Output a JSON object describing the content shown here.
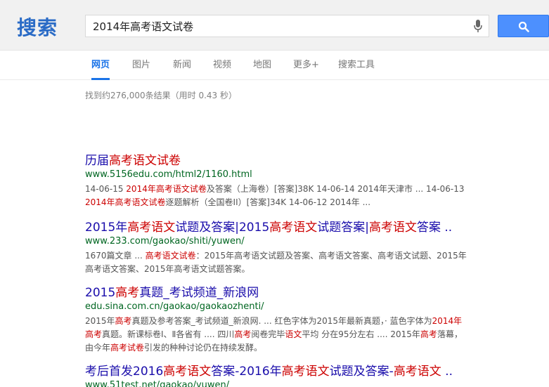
{
  "logo": "搜索",
  "search": {
    "query": "2014年高考语文试卷"
  },
  "tabs": [
    {
      "label": "网页",
      "active": true
    },
    {
      "label": "图片"
    },
    {
      "label": "新闻"
    },
    {
      "label": "视频"
    },
    {
      "label": "地图"
    },
    {
      "label": "更多+"
    },
    {
      "label": "搜索工具"
    }
  ],
  "stats": "找到约276,000条结果（用时 0.43 秒）",
  "results": [
    {
      "title": [
        {
          "t": "历届"
        },
        {
          "t": "高考语文试卷",
          "hl": true
        }
      ],
      "url": "www.5156edu.com/html2/1160.html",
      "snippet": [
        {
          "t": "14-06-15 "
        },
        {
          "t": "2014年高考语文试卷",
          "hl": true
        },
        {
          "t": "及答案（上海卷）[答案]38K 14-06-14 2014年天津市 ... 14-06-13 "
        },
        {
          "t": "2014年高考语文试卷",
          "hl": true
        },
        {
          "t": "逐题解析（全国卷II）[答案]34K 14-06-12 2014年 ..."
        }
      ]
    },
    {
      "title": [
        {
          "t": "2015年"
        },
        {
          "t": "高考语文",
          "hl": true
        },
        {
          "t": "试题及答案|2015"
        },
        {
          "t": "高考语文",
          "hl": true
        },
        {
          "t": "试题答案|"
        },
        {
          "t": "高考语文",
          "hl": true
        },
        {
          "t": "答案 .."
        }
      ],
      "url": "www.233.com/gaokao/shiti/yuwen/",
      "snippet": [
        {
          "t": "1670篇文章 ... "
        },
        {
          "t": "高考语文试卷",
          "hl": true
        },
        {
          "t": "：2015年高考语文试题及答案、高考语文答案、高考语文试题、2015年 高考语文答案、2015年高考语文试题答案。"
        }
      ]
    },
    {
      "title": [
        {
          "t": "2015"
        },
        {
          "t": "高考",
          "hl": true
        },
        {
          "t": "真题_考试频道_新浪网"
        }
      ],
      "url": "edu.sina.com.cn/gaokao/gaokaozhenti/",
      "snippet": [
        {
          "t": "2015年"
        },
        {
          "t": "高考",
          "hl": true
        },
        {
          "t": "真题及参考答案_考试频道_新浪网. ... 红色字体为2015年最新真题，· 蓝色字体为"
        },
        {
          "t": "2014年高考",
          "hl": true
        },
        {
          "t": "真题。新课标卷Ⅰ、Ⅱ各省有 .... 四川"
        },
        {
          "t": "高考",
          "hl": true
        },
        {
          "t": "阅卷完毕"
        },
        {
          "t": "语文",
          "hl": true
        },
        {
          "t": "平均 分在95分左右 .... 2015年"
        },
        {
          "t": "高考",
          "hl": true
        },
        {
          "t": "落幕，由今年"
        },
        {
          "t": "高考试卷",
          "hl": true
        },
        {
          "t": "引发的种种讨论仍在持续发酵。"
        }
      ]
    },
    {
      "title": [
        {
          "t": "考后首发2016"
        },
        {
          "t": "高考语文",
          "hl": true
        },
        {
          "t": "答案-2016年"
        },
        {
          "t": "高考语文",
          "hl": true
        },
        {
          "t": "试题及答案-"
        },
        {
          "t": "高考语文",
          "hl": true
        },
        {
          "t": " .."
        }
      ],
      "url": "www.51test.net/gaokao/yuwen/",
      "snippet": []
    }
  ]
}
